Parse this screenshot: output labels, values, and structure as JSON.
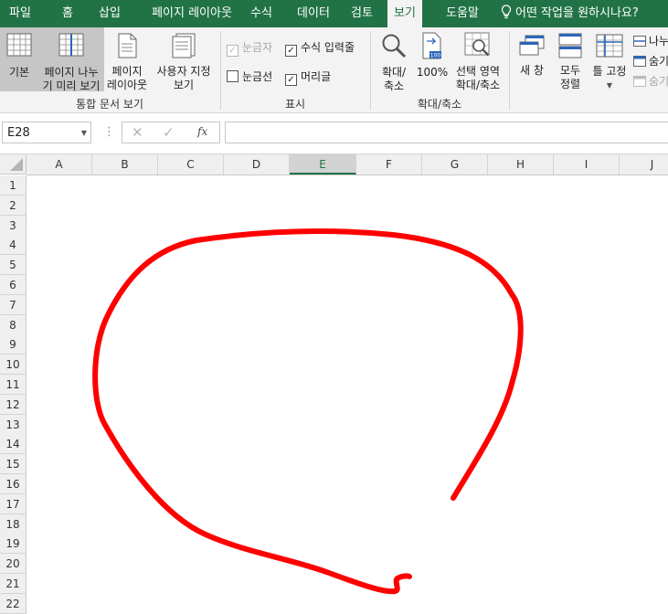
{
  "tabs": [
    "파일",
    "홈",
    "삽입",
    "페이지 레이아웃",
    "수식",
    "데이터",
    "검토",
    "보기",
    "도움말"
  ],
  "tell_me": "어떤 작업을 원하시나요?",
  "ribbon": {
    "workbook_views": {
      "normal_label": "기본",
      "page_break_line1": "페이지 나누",
      "page_break_line2": "기 미리 보기",
      "page_layout_line1": "페이지",
      "page_layout_line2": "레이아웃",
      "custom_line1": "사용자 지정",
      "custom_line2": "보기",
      "group_label": "통합 문서 보기"
    },
    "show": {
      "ruler": "눈금자",
      "formula_bar": "수식 입력줄",
      "gridlines": "눈금선",
      "headings": "머리글",
      "group_label": "표시"
    },
    "zoom": {
      "zoom_line1": "확대/",
      "zoom_line2": "축소",
      "hundred": "100%",
      "selection_line1": "선택 영역",
      "selection_line2": "확대/축소",
      "group_label": "확대/축소"
    },
    "window": {
      "new_window": "새 창",
      "arrange_line1": "모두",
      "arrange_line2": "정렬",
      "freeze": "틀 고정",
      "split": "나누",
      "hide": "숨기",
      "unhide": "숨기"
    }
  },
  "formula_bar": {
    "name_box": "E28",
    "fx": "fx",
    "formula": ""
  },
  "columns": [
    "A",
    "B",
    "C",
    "D",
    "E",
    "F",
    "G",
    "H",
    "I",
    "J"
  ],
  "rows": [
    "1",
    "2",
    "3",
    "4",
    "5",
    "6",
    "7",
    "8",
    "9",
    "10",
    "11",
    "12",
    "13",
    "14",
    "15",
    "16",
    "17",
    "18",
    "19",
    "20",
    "21",
    "22"
  ],
  "selected_column": "E",
  "colors": {
    "accent": "#217346",
    "ink": "#ff0000"
  }
}
